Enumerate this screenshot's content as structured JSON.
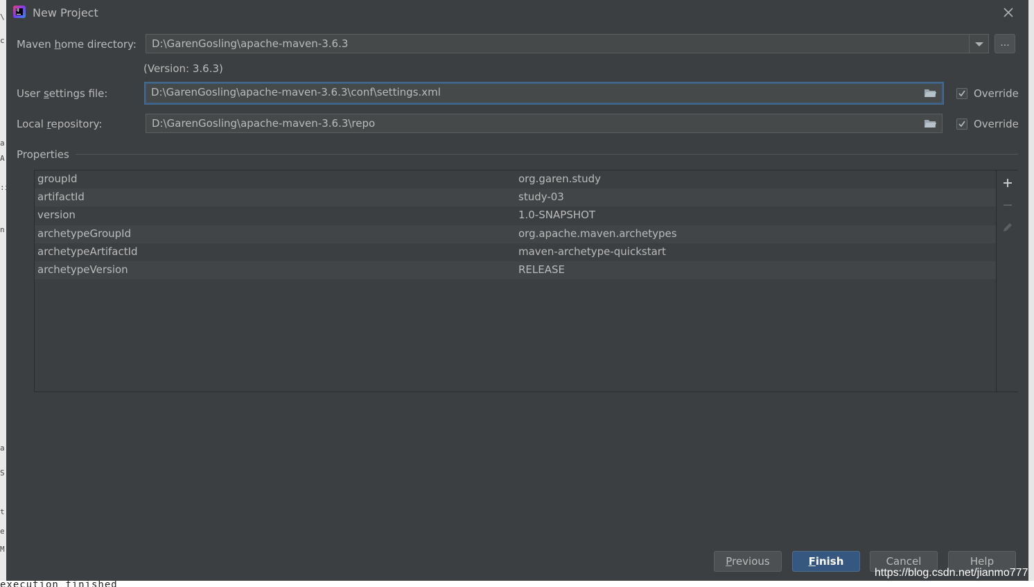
{
  "dialog": {
    "title": "New Project",
    "title_icon": "intellij-idea-icon"
  },
  "maven_home": {
    "label_pre": "Maven ",
    "label_mnemonic": "h",
    "label_post": "ome directory:",
    "value": "D:\\GarenGosling\\apache-maven-3.6.3",
    "version": "(Version: 3.6.3)",
    "browse_label": "..."
  },
  "user_settings": {
    "label_pre": "User ",
    "label_mnemonic": "s",
    "label_post": "ettings file:",
    "value": "D:\\GarenGosling\\apache-maven-3.6.3\\conf\\settings.xml",
    "override_label": "Override",
    "override_checked": true
  },
  "local_repo": {
    "label_pre": "Local ",
    "label_mnemonic": "r",
    "label_post": "epository:",
    "value": "D:\\GarenGosling\\apache-maven-3.6.3\\repo",
    "override_label": "Override",
    "override_checked": true
  },
  "properties": {
    "title": "Properties",
    "rows": [
      {
        "key": "groupId",
        "value": "org.garen.study"
      },
      {
        "key": "artifactId",
        "value": "study-03"
      },
      {
        "key": "version",
        "value": "1.0-SNAPSHOT"
      },
      {
        "key": "archetypeGroupId",
        "value": "org.apache.maven.archetypes"
      },
      {
        "key": "archetypeArtifactId",
        "value": "maven-archetype-quickstart"
      },
      {
        "key": "archetypeVersion",
        "value": "RELEASE"
      }
    ],
    "toolbar": [
      "add-icon",
      "remove-icon",
      "edit-icon"
    ]
  },
  "buttons": {
    "previous": {
      "mnemonic": "P",
      "rest": "revious"
    },
    "finish": {
      "mnemonic": "F",
      "rest": "inish"
    },
    "cancel": "Cancel",
    "help": "Help"
  },
  "background": {
    "console_text": "execution finished"
  },
  "watermark": "https://blog.csdn.net/jianmo777",
  "colors": {
    "dialog_bg": "#3c3f41",
    "field_bg": "#45494a",
    "focus_border": "#3d6185",
    "primary_button": "#365880",
    "text": "#bbbbbb"
  }
}
